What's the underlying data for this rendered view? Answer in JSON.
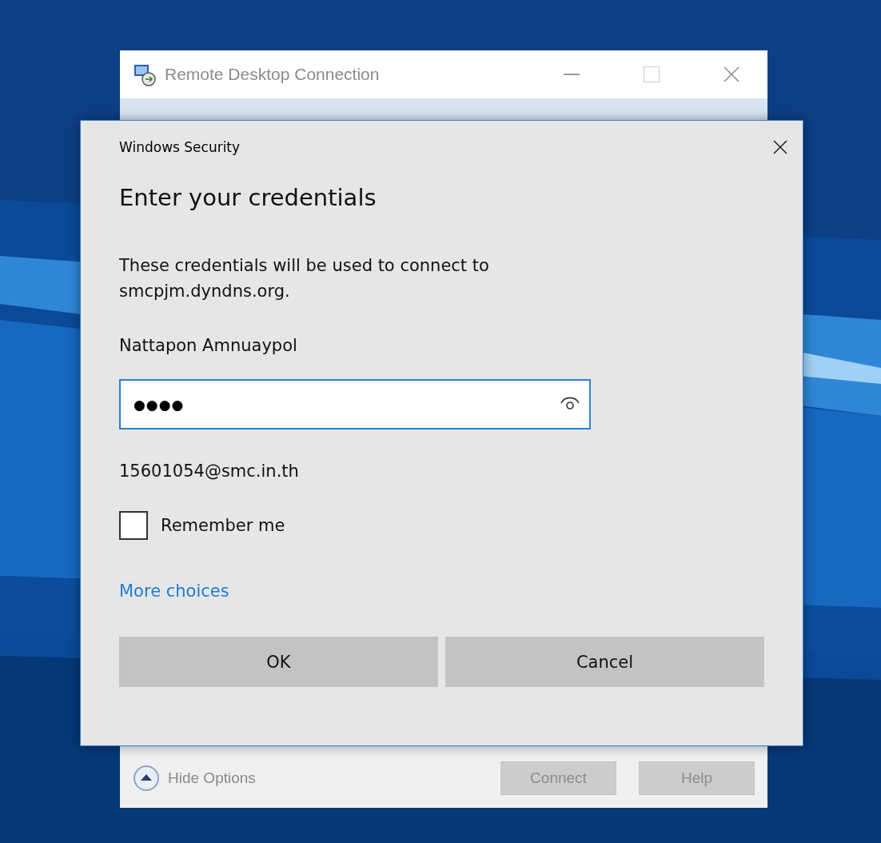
{
  "rdc_window": {
    "title": "Remote Desktop Connection",
    "hide_options": "Hide Options",
    "buttons": [
      {
        "label": "Connect",
        "disabled": true
      },
      {
        "label": "Help",
        "disabled": true
      }
    ]
  },
  "dialog": {
    "title": "Windows Security",
    "heading": "Enter your credentials",
    "message": "These credentials will be used to connect to smcpjm.dyndns.org.",
    "username": "Nattapon Amnuaypol",
    "password": {
      "value": "●●●●"
    },
    "account": "15601054@smc.in.th",
    "remember_me": {
      "label": "Remember me",
      "checked": false
    },
    "more_choices": "More choices",
    "buttons": [
      {
        "label": "OK"
      },
      {
        "label": "Cancel"
      }
    ]
  }
}
